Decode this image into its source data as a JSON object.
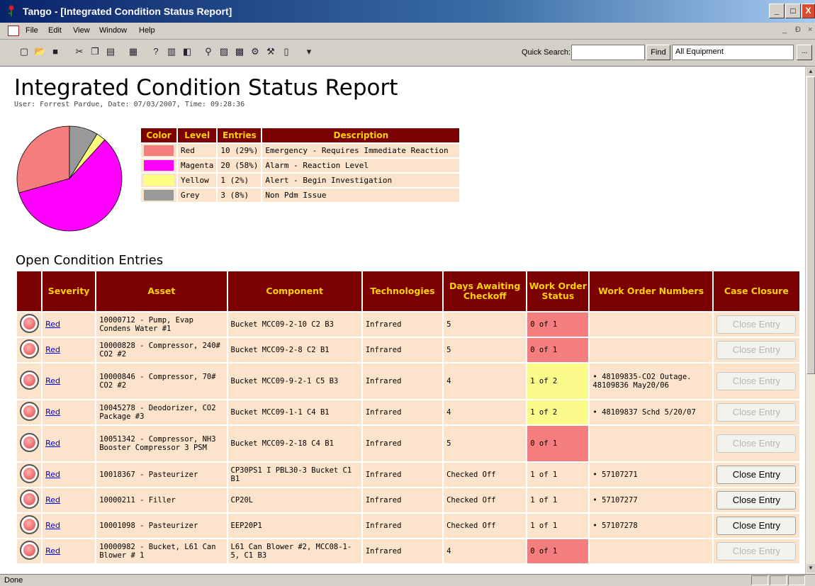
{
  "window": {
    "title": "Tango - [Integrated Condition Status Report]",
    "buttons": {
      "minimize": "_",
      "maximize": "□",
      "close": "X"
    }
  },
  "menu": {
    "items": [
      "File",
      "Edit",
      "View",
      "Window",
      "Help"
    ],
    "mdi_controls": [
      "_",
      "Ð",
      "×"
    ]
  },
  "toolbar": {
    "icons": [
      "new-icon",
      "open-icon",
      "save-icon",
      "cut-icon",
      "copy-icon",
      "paste-icon",
      "print-icon",
      "help-icon",
      "report-icon",
      "properties-icon",
      "find-icon",
      "chart-icon",
      "grid-icon",
      "tools-icon",
      "wrench-icon",
      "book-icon",
      "options-dropdown-icon"
    ],
    "quick_search_label": "Quick Search:",
    "quick_search_value": "",
    "find_label": "Find",
    "equipment_value": "All Equipment",
    "more_label": "..."
  },
  "report": {
    "title": "Integrated Condition Status Report",
    "subtitle": "User: Forrest Pardue, Date: 07/03/2007, Time: 09:28:36"
  },
  "chart_data": {
    "type": "pie",
    "categories": [
      "Red",
      "Magenta",
      "Yellow",
      "Grey"
    ],
    "values": [
      10,
      20,
      1,
      3
    ],
    "colors": [
      "#f47e7e",
      "#ff00ff",
      "#ffff80",
      "#999999"
    ]
  },
  "legend": {
    "headers": [
      "Color",
      "Level",
      "Entries",
      "Description"
    ],
    "rows": [
      {
        "color": "#f47e7e",
        "level": "Red",
        "entries": "10 (29%)",
        "description": "Emergency - Requires Immediate Reaction"
      },
      {
        "color": "#ff00ff",
        "level": "Magenta",
        "entries": "20 (58%)",
        "description": "Alarm - Reaction Level"
      },
      {
        "color": "#ffff80",
        "level": "Yellow",
        "entries": "1 (2%)",
        "description": "Alert - Begin Investigation"
      },
      {
        "color": "#999999",
        "level": "Grey",
        "entries": "3 (8%)",
        "description": "Non Pdm Issue"
      }
    ]
  },
  "entries": {
    "title": "Open Condition Entries",
    "headers": [
      "",
      "Severity",
      "Asset",
      "Component",
      "Technologies",
      "Days Awaiting Checkoff",
      "Work Order Status",
      "Work Order Numbers",
      "Case Closure"
    ],
    "rows": [
      {
        "severity": "Red",
        "asset": "10000712 - Pump, Evap Condens Water #1",
        "component": "Bucket MCC09-2-10 C2 B3",
        "tech": "Infrared",
        "days": "5",
        "wo_status": "0 of 1",
        "wo_status_color": "red",
        "wo_numbers": [],
        "closure": "Close Entry",
        "closure_enabled": false
      },
      {
        "severity": "Red",
        "asset": "10000828 - Compressor, 240# CO2 #2",
        "component": "Bucket MCC09-2-8 C2 B1",
        "tech": "Infrared",
        "days": "5",
        "wo_status": "0 of 1",
        "wo_status_color": "red",
        "wo_numbers": [],
        "closure": "Close Entry",
        "closure_enabled": false
      },
      {
        "severity": "Red",
        "asset": "10000846 - Compressor, 70# CO2 #2",
        "component": "Bucket MCC09-9-2-1 C5 B3",
        "tech": "Infrared",
        "days": "4",
        "wo_status": "1 of 2",
        "wo_status_color": "yellow",
        "wo_numbers": [
          "48109835-CO2 Outage. 48109836 May20/06"
        ],
        "closure": "Close Entry",
        "closure_enabled": false
      },
      {
        "severity": "Red",
        "asset": "10045278 - Deodorizer, CO2 Package #3",
        "component": "Bucket MCC09-1-1 C4 B1",
        "tech": "Infrared",
        "days": "4",
        "wo_status": "1 of 2",
        "wo_status_color": "yellow",
        "wo_numbers": [
          "48109837 Schd 5/20/07"
        ],
        "closure": "Close Entry",
        "closure_enabled": false
      },
      {
        "severity": "Red",
        "asset": "10051342 - Compressor, NH3 Booster Compressor 3 PSM",
        "component": "Bucket MCC09-2-18 C4 B1",
        "tech": "Infrared",
        "days": "5",
        "wo_status": "0 of 1",
        "wo_status_color": "red",
        "wo_numbers": [],
        "closure": "Close Entry",
        "closure_enabled": false
      },
      {
        "severity": "Red",
        "asset": "10018367 - Pasteurizer",
        "component": "CP30PS1 I PBL30-3 Bucket C1 B1",
        "tech": "Infrared",
        "days": "Checked Off",
        "wo_status": "1 of 1",
        "wo_status_color": "none",
        "wo_numbers": [
          "57107271"
        ],
        "closure": "Close Entry",
        "closure_enabled": true
      },
      {
        "severity": "Red",
        "asset": "10000211 - Filler",
        "component": "CP20L",
        "tech": "Infrared",
        "days": "Checked Off",
        "wo_status": "1 of 1",
        "wo_status_color": "none",
        "wo_numbers": [
          "57107277"
        ],
        "closure": "Close Entry",
        "closure_enabled": true
      },
      {
        "severity": "Red",
        "asset": "10001098 - Pasteurizer",
        "component": "EEP20P1",
        "tech": "Infrared",
        "days": "Checked Off",
        "wo_status": "1 of 1",
        "wo_status_color": "none",
        "wo_numbers": [
          "57107278"
        ],
        "closure": "Close Entry",
        "closure_enabled": true
      },
      {
        "severity": "Red",
        "asset": "10000982 - Bucket, L61 Can Blower # 1",
        "component": "L61 Can Blower #2, MCC08-1-5, C1 B3",
        "tech": "Infrared",
        "days": "4",
        "wo_status": "0 of 1",
        "wo_status_color": "red",
        "wo_numbers": [],
        "closure": "Close Entry",
        "closure_enabled": false
      }
    ]
  },
  "statusbar": {
    "text": "Done"
  }
}
